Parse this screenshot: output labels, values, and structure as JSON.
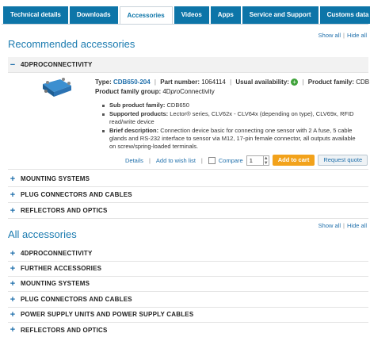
{
  "tabs": [
    {
      "label": "Technical details",
      "active": false
    },
    {
      "label": "Downloads",
      "active": false
    },
    {
      "label": "Accessories",
      "active": true
    },
    {
      "label": "Videos",
      "active": false
    },
    {
      "label": "Apps",
      "active": false
    },
    {
      "label": "Service and Support",
      "active": false
    },
    {
      "label": "Customs data",
      "active": false
    }
  ],
  "links": {
    "show_all": "Show all",
    "hide_all": "Hide all"
  },
  "recommended": {
    "heading": "Recommended accessories",
    "expanded_group": "4DPROCONNECTIVITY",
    "product": {
      "type_label": "Type:",
      "type_value": "CDB650-204",
      "part_label": "Part number:",
      "part_value": "1064114",
      "availability_label": "Usual availability:",
      "availability_icon": "ok-icon",
      "family_label": "Product family:",
      "family_value": "CDB",
      "family_group_label": "Product family group:",
      "family_group_value": "4D",
      "family_group_value_italic": "pro",
      "family_group_value_rest": "Connectivity",
      "sub_label": "Sub product family:",
      "sub_value": "CDB650",
      "supported_label": "Supported products:",
      "supported_value": "Lector® series, CLV62x - CLV64x (depending on type), CLV69x, RFID read/write device",
      "brief_label": "Brief description:",
      "brief_value": "Connection device basic for connecting one sensor with 2 A fuse, 5 cable glands and RS-232 interface to sensor via M12, 17-pin female connector, all outputs available on screw/spring-loaded terminals."
    },
    "actions": {
      "details": "Details",
      "wishlist": "Add to wish list",
      "compare": "Compare",
      "quantity": "1",
      "add_to_cart": "Add to cart",
      "request_quote": "Request quote"
    },
    "collapsed": [
      "MOUNTING SYSTEMS",
      "PLUG CONNECTORS AND CABLES",
      "REFLECTORS AND OPTICS"
    ]
  },
  "all": {
    "heading": "All accessories",
    "groups": [
      "4DPROCONNECTIVITY",
      "FURTHER ACCESSORIES",
      "MOUNTING SYSTEMS",
      "PLUG CONNECTORS AND CABLES",
      "POWER SUPPLY UNITS AND POWER SUPPLY CABLES",
      "REFLECTORS AND OPTICS"
    ]
  },
  "colors": {
    "brand_blue": "#0d75a8",
    "link_blue": "#1f6fab",
    "cart_orange": "#f2a21b",
    "ok_green": "#3fa33a"
  }
}
